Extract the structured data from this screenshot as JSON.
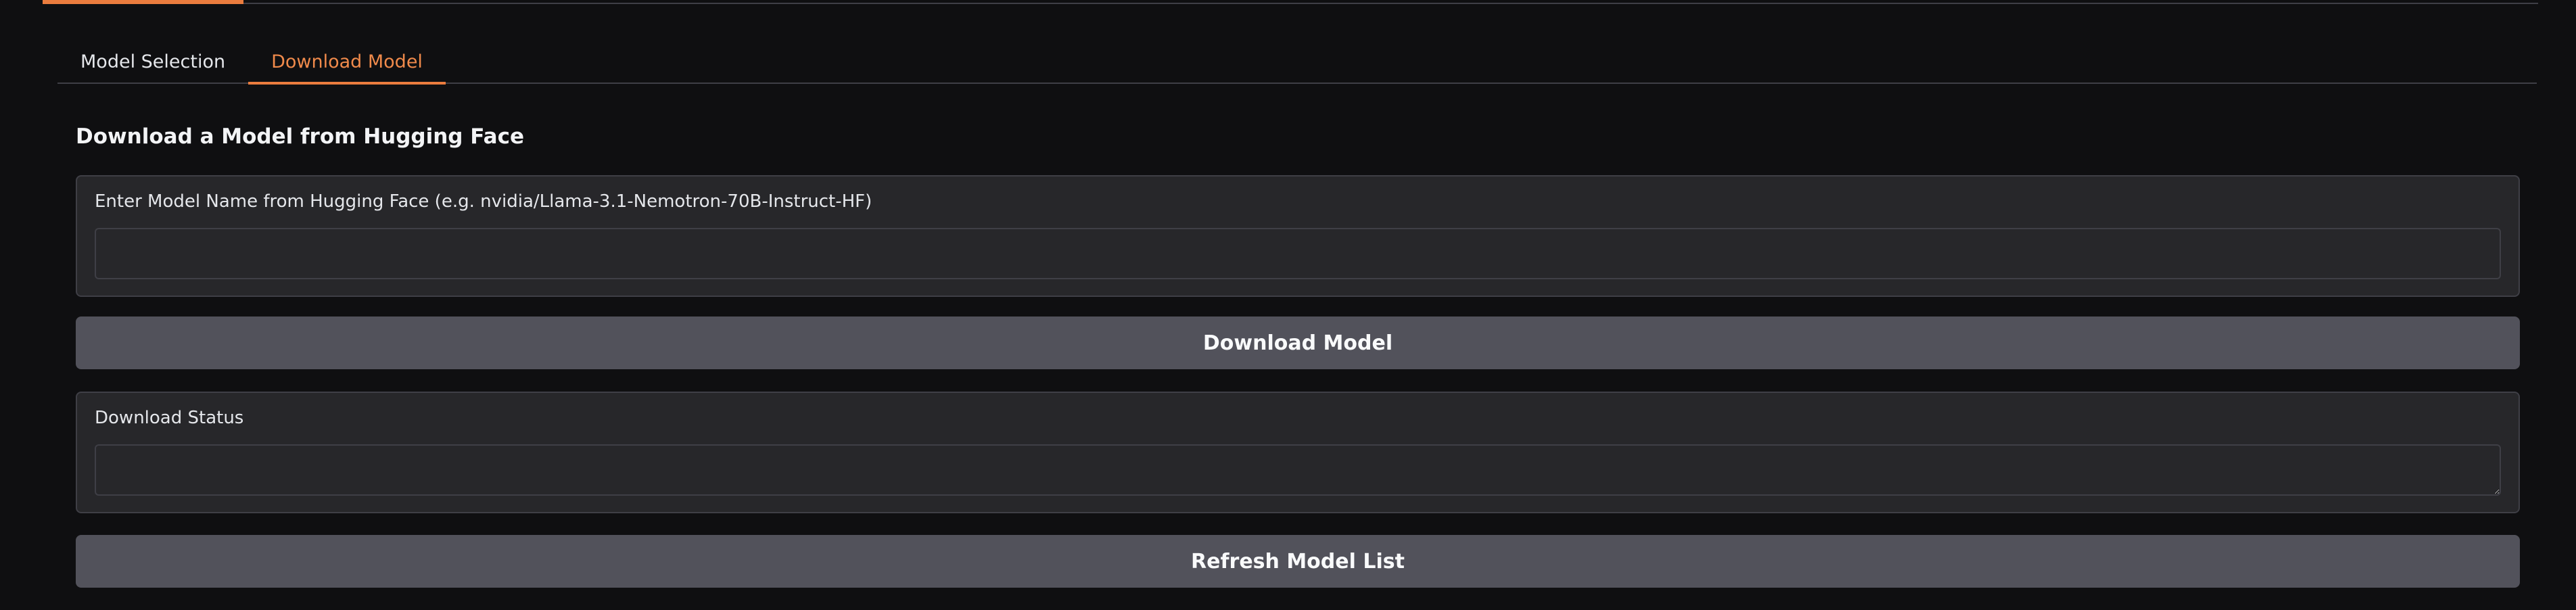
{
  "tabs": [
    {
      "label": "Model Selection",
      "active": false
    },
    {
      "label": "Download Model",
      "active": true
    }
  ],
  "section": {
    "title": "Download a Model from Hugging Face"
  },
  "model_name_field": {
    "label": "Enter Model Name from Hugging Face (e.g. nvidia/Llama-3.1-Nemotron-70B-Instruct-HF)",
    "value": ""
  },
  "download_button": {
    "label": "Download Model"
  },
  "status_field": {
    "label": "Download Status",
    "value": ""
  },
  "refresh_button": {
    "label": "Refresh Model List"
  },
  "colors": {
    "background": "#0f0f11",
    "panel": "#27272a",
    "border": "#3f3f46",
    "button": "#52525b",
    "accent": "#ea7c3e"
  }
}
